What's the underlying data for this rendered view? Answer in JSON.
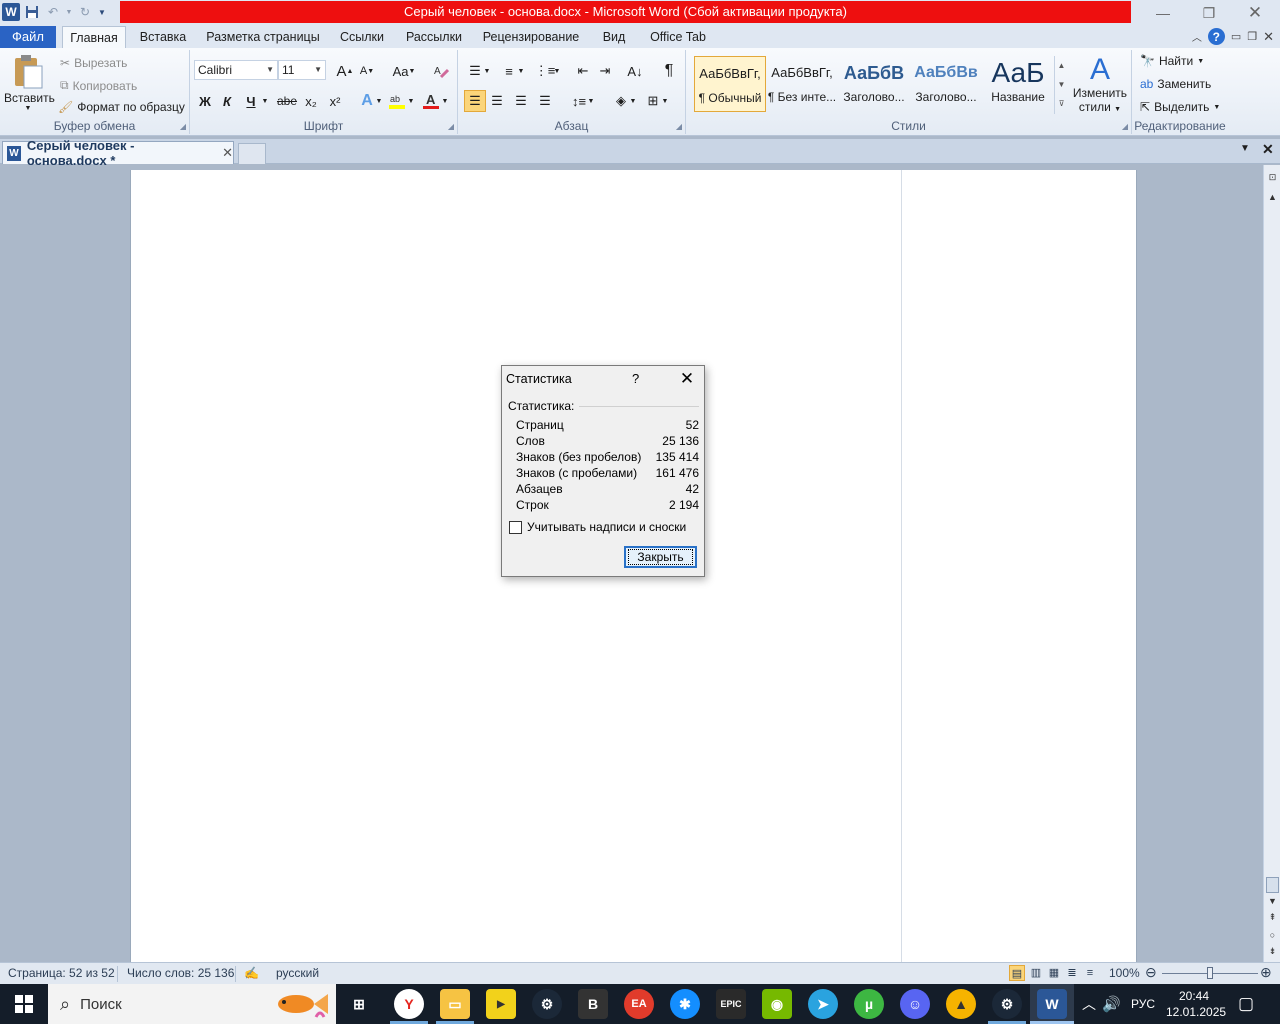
{
  "titlebar": {
    "title": "Серый человек - основа.docx  -  Microsoft Word (Сбой активации продукта)"
  },
  "ribbon_tabs": {
    "file": "Файл",
    "tabs": [
      "Главная",
      "Вставка",
      "Разметка страницы",
      "Ссылки",
      "Рассылки",
      "Рецензирование",
      "Вид",
      "Office Tab"
    ]
  },
  "clipboard": {
    "paste": "Вставить",
    "cut": "Вырезать",
    "copy": "Копировать",
    "format_painter": "Формат по образцу",
    "label": "Буфер обмена"
  },
  "font": {
    "name": "Calibri",
    "size": "11",
    "label": "Шрифт",
    "bold": "Ж",
    "italic": "К",
    "underline": "Ч",
    "strike": "abe",
    "subscript": "x₂",
    "superscript": "x²",
    "case": "Aa",
    "grow": "A",
    "shrink": "A"
  },
  "paragraph": {
    "label": "Абзац"
  },
  "styles": {
    "label": "Стили",
    "items": [
      {
        "preview": "АаБбВвГг,",
        "name": "¶ Обычный"
      },
      {
        "preview": "АаБбВвГг,",
        "name": "¶ Без инте..."
      },
      {
        "preview": "АаБбВ",
        "name": "Заголово..."
      },
      {
        "preview": "АаБбВв",
        "name": "Заголово..."
      },
      {
        "preview": "АаБ",
        "name": "Название"
      }
    ],
    "change_styles_line1": "Изменить",
    "change_styles_line2": "стили"
  },
  "editing": {
    "label": "Редактирование",
    "find": "Найти",
    "replace": "Заменить",
    "select": "Выделить"
  },
  "doc_tab": {
    "title": "Серый человек - основа.docx *"
  },
  "dialog": {
    "title": "Статистика",
    "help": "?",
    "section": "Статистика:",
    "rows": [
      {
        "label": "Страниц",
        "value": "52"
      },
      {
        "label": "Слов",
        "value": "25 136"
      },
      {
        "label": "Знаков (без пробелов)",
        "value": "135 414"
      },
      {
        "label": "Знаков (с пробелами)",
        "value": "161 476"
      },
      {
        "label": "Абзацев",
        "value": "42"
      },
      {
        "label": "Строк",
        "value": "2 194"
      }
    ],
    "checkbox_label": "Учитывать надписи и сноски",
    "close_button": "Закрыть"
  },
  "statusbar": {
    "page": "Страница: 52 из 52",
    "words": "Число слов: 25 136",
    "language": "русский",
    "zoom": "100%"
  },
  "taskbar": {
    "search_placeholder": "Поиск",
    "language": "РУС",
    "time": "20:44",
    "date": "12.01.2025",
    "icons": [
      "task-view",
      "yandex-browser",
      "file-explorer",
      "player",
      "steam",
      "vk",
      "ea",
      "battle-net",
      "epic-games",
      "nvidia",
      "telegram",
      "utorrent",
      "discord",
      "aimp",
      "steam-2",
      "word"
    ]
  },
  "colors": {
    "title_red": "#ee0f0f",
    "file_tab_blue": "#2a63c4",
    "ribbon_bg": "#f8fafd",
    "doc_bg": "#abb8c9",
    "taskbar": "#141d29"
  }
}
